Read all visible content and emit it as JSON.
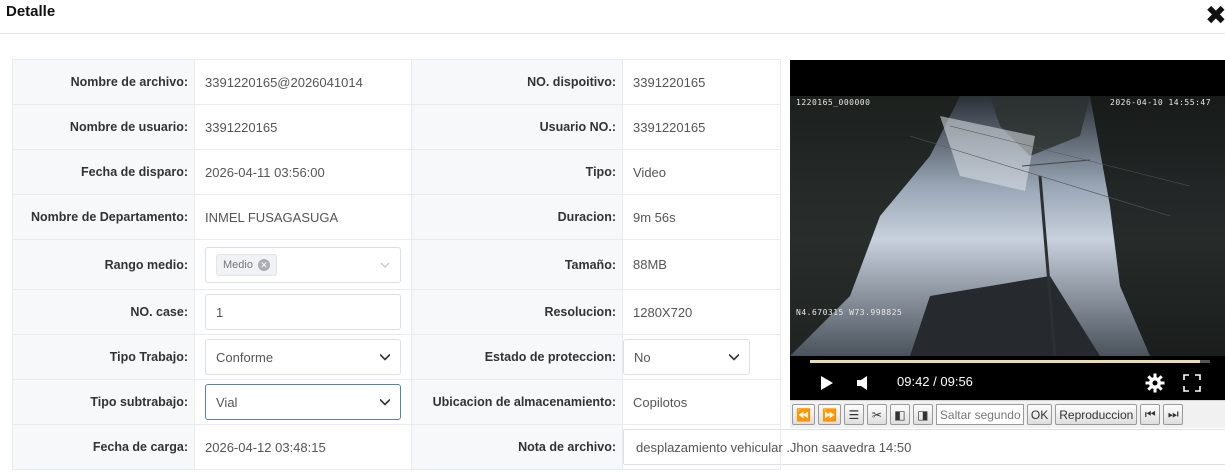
{
  "dialog": {
    "title": "Detalle"
  },
  "fields": {
    "nombre_archivo": {
      "label": "Nombre de archivo:",
      "value": "3391220165@2026041014"
    },
    "no_dispositivo": {
      "label": "NO. dispoitivo:",
      "value": "3391220165"
    },
    "nombre_usuario": {
      "label": "Nombre de usuario:",
      "value": "3391220165"
    },
    "usuario_no": {
      "label": "Usuario NO.:",
      "value": "3391220165"
    },
    "fecha_disparo": {
      "label": "Fecha de disparo:",
      "value": "2026-04-11 03:56:00"
    },
    "tipo": {
      "label": "Tipo:",
      "value": "Video"
    },
    "departamento": {
      "label": "Nombre de Departamento:",
      "value": "INMEL FUSAGASUGA"
    },
    "duracion": {
      "label": "Duracion:",
      "value": "9m 56s"
    },
    "rango_medio": {
      "label": "Rango medio:",
      "tag": "Medio"
    },
    "tamano": {
      "label": "Tamaño:",
      "value": "88MB"
    },
    "no_case": {
      "label": "NO. case:",
      "value": "1"
    },
    "resolucion": {
      "label": "Resolucion:",
      "value": "1280X720"
    },
    "tipo_trabajo": {
      "label": "Tipo Trabajo:",
      "value": "Conforme"
    },
    "estado_proteccion": {
      "label": "Estado de proteccion:",
      "value": "No"
    },
    "tipo_subtrabajo": {
      "label": "Tipo subtrabajo:",
      "value": "Vial"
    },
    "ubicacion": {
      "label": "Ubicacion de almacenamiento:",
      "value": "Copilotos"
    },
    "fecha_carga": {
      "label": "Fecha de carga:",
      "value": "2026-04-12 03:48:15"
    },
    "nota_archivo": {
      "label": "Nota de archivo:",
      "value": "desplazamiento vehicular .Jhon saavedra 14:50"
    }
  },
  "player": {
    "osd_device": "1220165_000000",
    "osd_datetime": "2026-04-10 14:55:47",
    "osd_coords": "N4.670315 W73.998825",
    "time": "09:42 / 09:56",
    "progress": 0.976,
    "colors": {
      "progress_fill": "#e9dcb6",
      "background": "#000000"
    }
  },
  "toolbar": {
    "seek_placeholder": "Saltar segundo",
    "ok_label": "OK",
    "playback_label": "Reproduccion",
    "icons": [
      "rewind-icon",
      "fast-forward-icon",
      "list-icon",
      "scissors-icon",
      "prev-frame-icon",
      "next-frame-icon",
      "skip-start-icon",
      "skip-end-icon"
    ]
  },
  "colors": {
    "label_bg": "#f7f8fa",
    "border": "#e9ecef",
    "focus_border": "#5b7fb5"
  }
}
